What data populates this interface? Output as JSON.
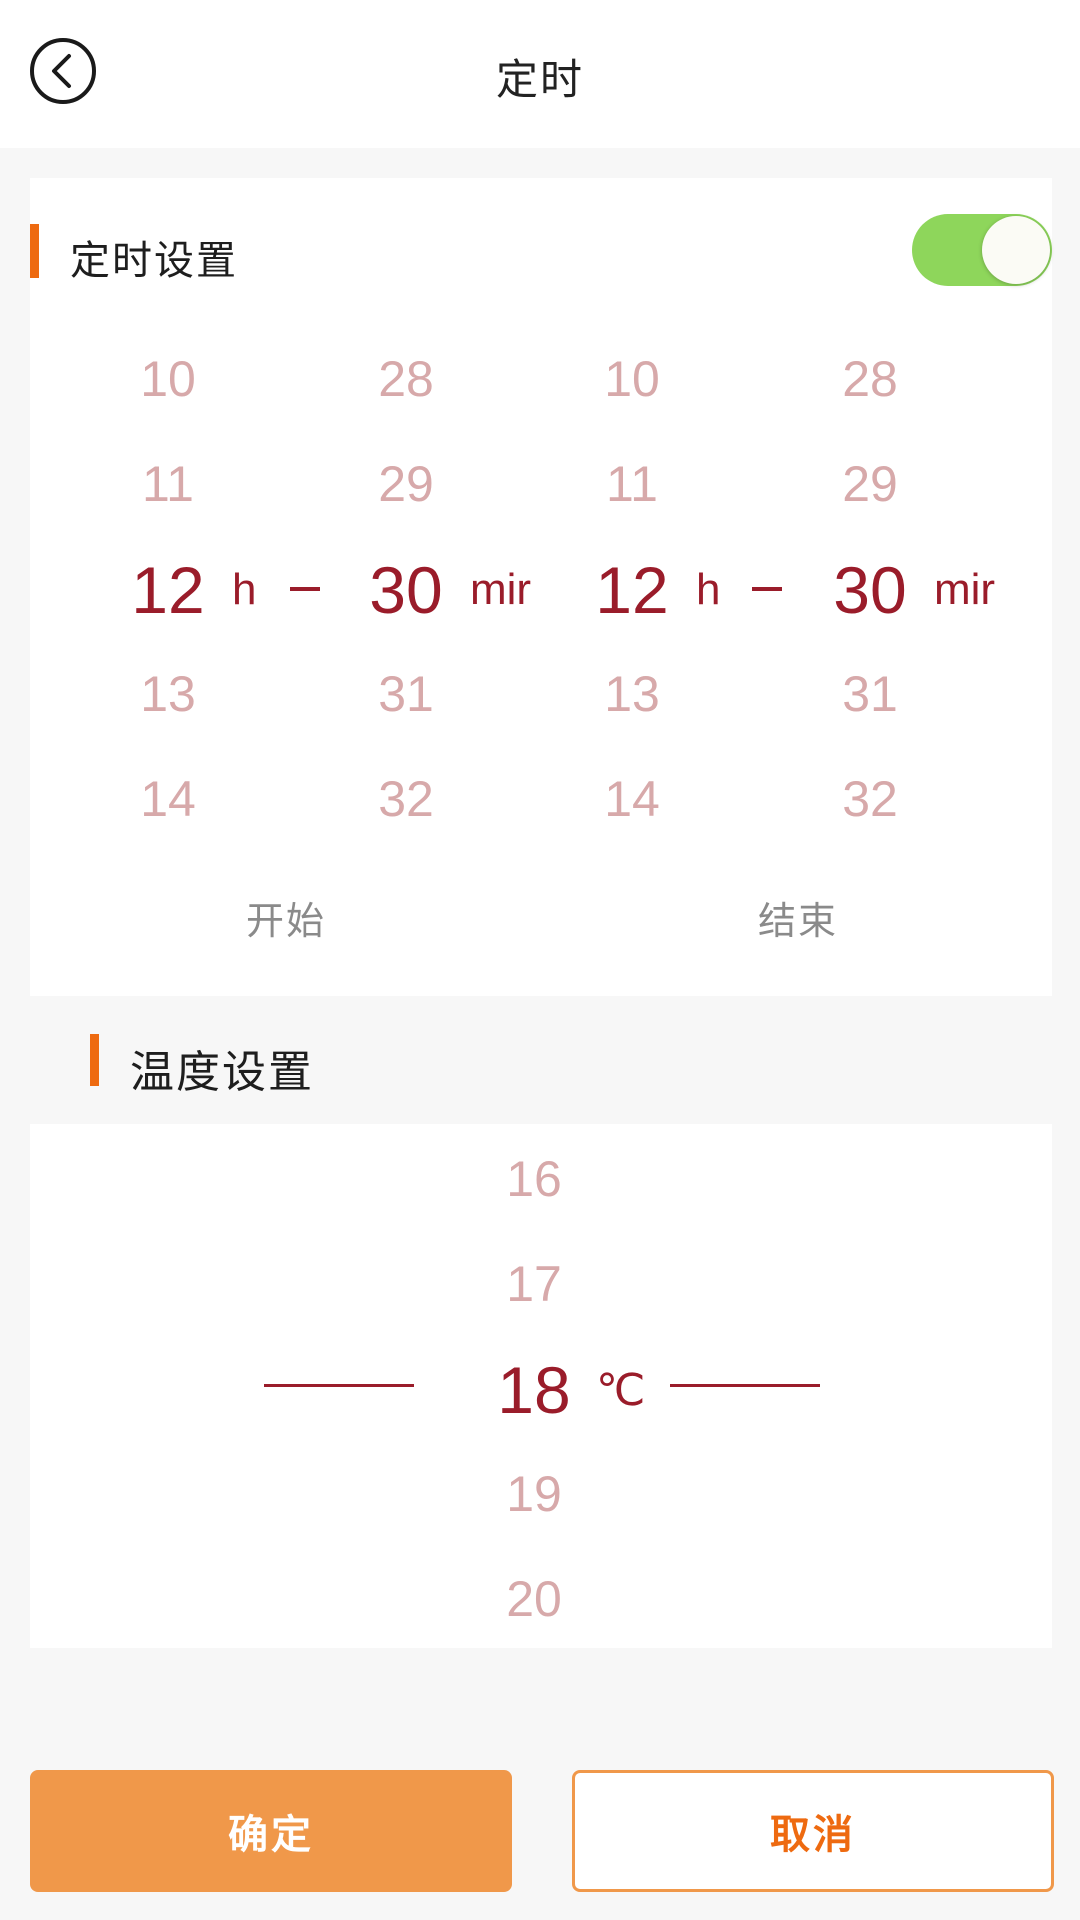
{
  "header": {
    "title": "定时",
    "back_icon": "back-chevron-icon"
  },
  "timer": {
    "section_title": "定时设置",
    "enabled": true,
    "start": {
      "label": "开始",
      "hours": [
        "10",
        "11",
        "12",
        "13",
        "14"
      ],
      "minutes": [
        "28",
        "29",
        "30",
        "31",
        "32"
      ],
      "hour_unit": "h",
      "minute_unit": "mir"
    },
    "end": {
      "label": "结束",
      "hours": [
        "10",
        "11",
        "12",
        "13",
        "14"
      ],
      "minutes": [
        "28",
        "29",
        "30",
        "31",
        "32"
      ],
      "hour_unit": "h",
      "minute_unit": "mir"
    }
  },
  "temperature": {
    "section_title": "温度设置",
    "values": [
      "16",
      "17",
      "18",
      "19",
      "20"
    ],
    "unit": "℃"
  },
  "buttons": {
    "confirm": "确定",
    "cancel": "取消"
  },
  "colors": {
    "accent": "#ee6a10",
    "selected_value": "#9a1c2a",
    "unselected_value": "#d7a9aa",
    "toggle_on": "#8ed65b"
  }
}
